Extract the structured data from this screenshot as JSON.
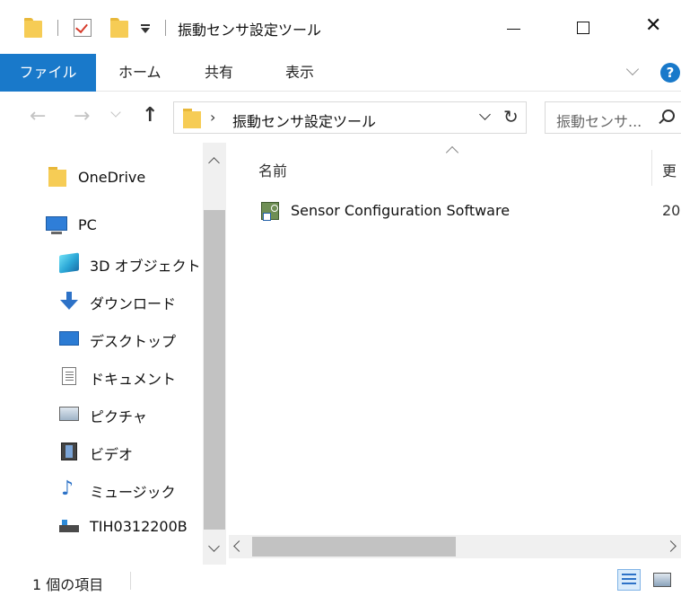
{
  "window": {
    "title": "振動センサ設定ツール",
    "minimize_glyph": "—",
    "maximize_glyph": "☐",
    "close_glyph": "✕"
  },
  "quick_access": {
    "icons": [
      "folder-icon",
      "properties-check-icon",
      "new-folder-icon",
      "customize-dropdown-icon"
    ]
  },
  "ribbon": {
    "file_tab": "ファイル",
    "tabs": [
      "ホーム",
      "共有",
      "表示"
    ],
    "help_glyph": "?"
  },
  "navigation": {
    "back_glyph": "←",
    "forward_glyph": "→",
    "up_glyph": "↑",
    "address_separator": "›",
    "address_path": "振動センサ設定ツール",
    "refresh_glyph": "↻",
    "search_placeholder": "振動センサ..."
  },
  "nav_pane": {
    "items": [
      {
        "label": "OneDrive",
        "icon": "onedrive-folder-icon"
      },
      {
        "label": "PC",
        "icon": "pc-icon"
      },
      {
        "label": "3D オブジェクト",
        "icon": "3d-objects-icon"
      },
      {
        "label": "ダウンロード",
        "icon": "downloads-icon"
      },
      {
        "label": "デスクトップ",
        "icon": "desktop-icon"
      },
      {
        "label": "ドキュメント",
        "icon": "documents-icon"
      },
      {
        "label": "ピクチャ",
        "icon": "pictures-icon"
      },
      {
        "label": "ビデオ",
        "icon": "videos-icon"
      },
      {
        "label": "ミュージック",
        "icon": "music-icon"
      },
      {
        "label": "TIH0312200B",
        "icon": "network-drive-icon"
      }
    ]
  },
  "content": {
    "columns": {
      "name": "名前",
      "date": "更"
    },
    "files": [
      {
        "name": "Sensor Configuration Software",
        "date": "20",
        "icon": "application-shortcut-icon"
      }
    ]
  },
  "status": {
    "item_count": "1 個の項目"
  },
  "colors": {
    "accent": "#1979ca",
    "folder": "#f6cc55"
  }
}
